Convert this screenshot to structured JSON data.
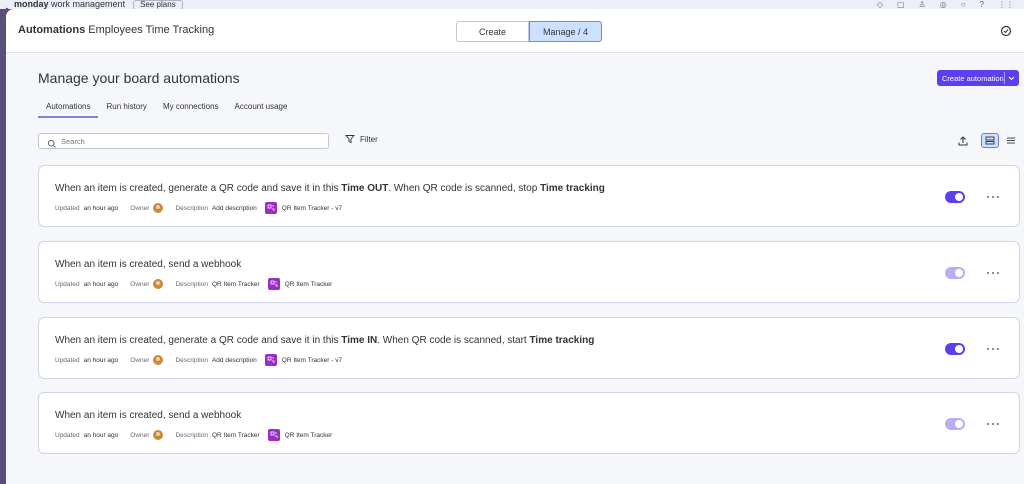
{
  "app": {
    "brand_bold": "monday",
    "brand_rest": "work management",
    "see_plans": "See plans"
  },
  "header": {
    "title_bold": "Automations",
    "title_rest": " Employees Time Tracking",
    "segment_create": "Create",
    "segment_manage": "Manage / 4"
  },
  "main": {
    "heading": "Manage your board automations",
    "create_button": "Create automation",
    "tabs": [
      {
        "label": "Automations",
        "active": true
      },
      {
        "label": "Run history",
        "active": false
      },
      {
        "label": "My connections",
        "active": false
      },
      {
        "label": "Account usage",
        "active": false
      }
    ],
    "search_placeholder": "Search",
    "filter_label": "Filter"
  },
  "automations": [
    {
      "parts": [
        {
          "text": "When an item is created, generate a QR code and save it in this ",
          "bold": false
        },
        {
          "text": "Time OUT",
          "bold": true
        },
        {
          "text": ". When QR code is scanned, stop ",
          "bold": false
        },
        {
          "text": "Time tracking",
          "bold": true
        }
      ],
      "updated_label": "Updated",
      "updated_value": "an hour ago",
      "owner_label": "Owner",
      "description_label": "Description",
      "description_value": "Add description",
      "app_name": "QR Item Tracker - v7",
      "enabled": true
    },
    {
      "parts": [
        {
          "text": "When an item is created, send a webhook",
          "bold": false
        }
      ],
      "updated_label": "Updated",
      "updated_value": "an hour ago",
      "owner_label": "Owner",
      "description_label": "Description",
      "description_value": "QR Item Tracker",
      "app_name": "QR Item Tracker",
      "enabled": false
    },
    {
      "parts": [
        {
          "text": "When an item is created, generate a QR code and save it in this ",
          "bold": false
        },
        {
          "text": "Time IN",
          "bold": true
        },
        {
          "text": ". When QR code is scanned, start ",
          "bold": false
        },
        {
          "text": "Time tracking",
          "bold": true
        }
      ],
      "updated_label": "Updated",
      "updated_value": "an hour ago",
      "owner_label": "Owner",
      "description_label": "Description",
      "description_value": "Add description",
      "app_name": "QR Item Tracker - v7",
      "enabled": true
    },
    {
      "parts": [
        {
          "text": "When an item is created, send a webhook",
          "bold": false
        }
      ],
      "updated_label": "Updated",
      "updated_value": "an hour ago",
      "owner_label": "Owner",
      "description_label": "Description",
      "description_value": "QR Item Tracker",
      "app_name": "QR Item Tracker",
      "enabled": false
    }
  ],
  "colors": {
    "accent": "#5b3ff0",
    "toggle_disabled": "#b9aef5",
    "app_icon": "#9b2cc6",
    "active_segment": "#cce0ff"
  }
}
